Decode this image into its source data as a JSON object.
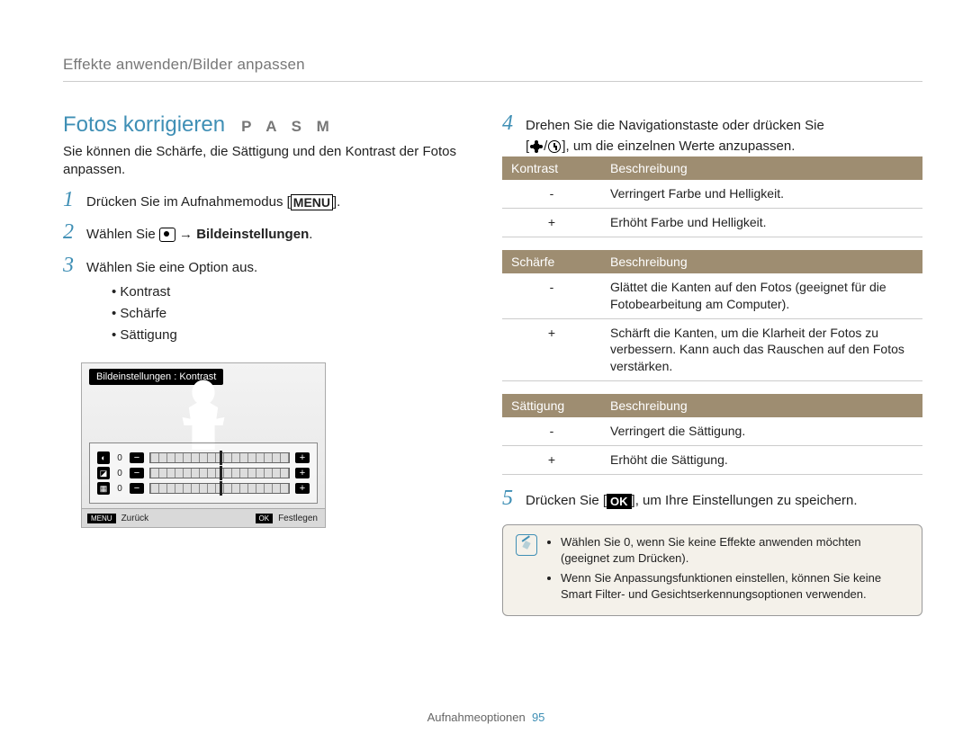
{
  "breadcrumb": "Effekte anwenden/Bilder anpassen",
  "heading": "Fotos korrigieren",
  "mode_letters": "P A S M",
  "intro": "Sie können die Schärfe, die Sättigung und den Kontrast der Fotos anpassen.",
  "steps": {
    "s1_pre": "Drücken Sie im Aufnahmemodus [",
    "s1_btn": "MENU",
    "s1_post": "].",
    "s2_pre": "Wählen Sie ",
    "s2_arrow": " → ",
    "s2_bold": "Bildeinstellungen",
    "s2_post": ".",
    "s3": "Wählen Sie eine Option aus.",
    "s3_opts": [
      "Kontrast",
      "Schärfe",
      "Sättigung"
    ],
    "s4_line1": "Drehen Sie die Navigationstaste oder drücken Sie",
    "s4_line2_pre": "[",
    "s4_line2_mid": "/",
    "s4_line2_post": "], um die einzelnen Werte anzupassen.",
    "s5_pre": "Drücken Sie [",
    "s5_btn": "OK",
    "s5_post": "], um Ihre Einstellungen zu speichern."
  },
  "screen": {
    "title": "Bildeinstellungen : Kontrast",
    "back_btn": "MENU",
    "back": "Zurück",
    "set_btn": "OK",
    "set": "Festlegen",
    "rows": [
      {
        "icon": "◐",
        "val": "0"
      },
      {
        "icon": "◪",
        "val": "0"
      },
      {
        "icon": "▦",
        "val": "0"
      }
    ]
  },
  "tables": [
    {
      "h1": "Kontrast",
      "h2": "Beschreibung",
      "rows": [
        {
          "k": "-",
          "v": "Verringert Farbe und Helligkeit."
        },
        {
          "k": "+",
          "v": "Erhöht Farbe und Helligkeit."
        }
      ]
    },
    {
      "h1": "Schärfe",
      "h2": "Beschreibung",
      "rows": [
        {
          "k": "-",
          "v": "Glättet die Kanten auf den Fotos (geeignet für die Fotobearbeitung am Computer)."
        },
        {
          "k": "+",
          "v": "Schärft die Kanten, um die Klarheit der Fotos zu verbessern. Kann auch das Rauschen auf den Fotos verstärken."
        }
      ]
    },
    {
      "h1": "Sättigung",
      "h2": "Beschreibung",
      "rows": [
        {
          "k": "-",
          "v": "Verringert die Sättigung."
        },
        {
          "k": "+",
          "v": "Erhöht die Sättigung."
        }
      ]
    }
  ],
  "note": {
    "items": [
      "Wählen Sie 0, wenn Sie keine Effekte anwenden möchten (geeignet zum Drücken).",
      "Wenn Sie Anpassungsfunktionen einstellen, können Sie keine Smart Filter- und Gesichtserkennungsoptionen verwenden."
    ]
  },
  "footer": {
    "section": "Aufnahmeoptionen",
    "page": "95"
  }
}
